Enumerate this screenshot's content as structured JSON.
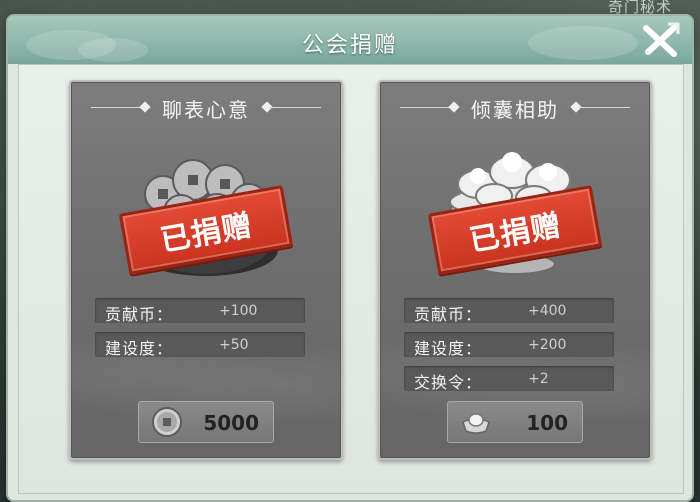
{
  "background": {
    "corner_label": "奇门秘术"
  },
  "dialog": {
    "title": "公会捐赠",
    "close_icon": "close-x-icon"
  },
  "cards": [
    {
      "title": "聊表心意",
      "status_stamp": "已捐赠",
      "item_icon": "copper-coins-pouch-icon",
      "stats": [
        {
          "label": "贡献币：",
          "value": "+100"
        },
        {
          "label": "建设度：",
          "value": "+50"
        }
      ],
      "cost": {
        "icon": "coin-icon",
        "amount": "5000"
      }
    },
    {
      "title": "倾囊相助",
      "status_stamp": "已捐赠",
      "item_icon": "silver-ingots-pot-icon",
      "stats": [
        {
          "label": "贡献币：",
          "value": "+400"
        },
        {
          "label": "建设度：",
          "value": "+200"
        },
        {
          "label": "交换令：",
          "value": "+2"
        }
      ],
      "cost": {
        "icon": "silver-ingot-icon",
        "amount": "100"
      }
    }
  ],
  "colors": {
    "title_bar": "#8fb7ab",
    "stamp_red": "#d23a25",
    "card_gray": "#727272"
  }
}
